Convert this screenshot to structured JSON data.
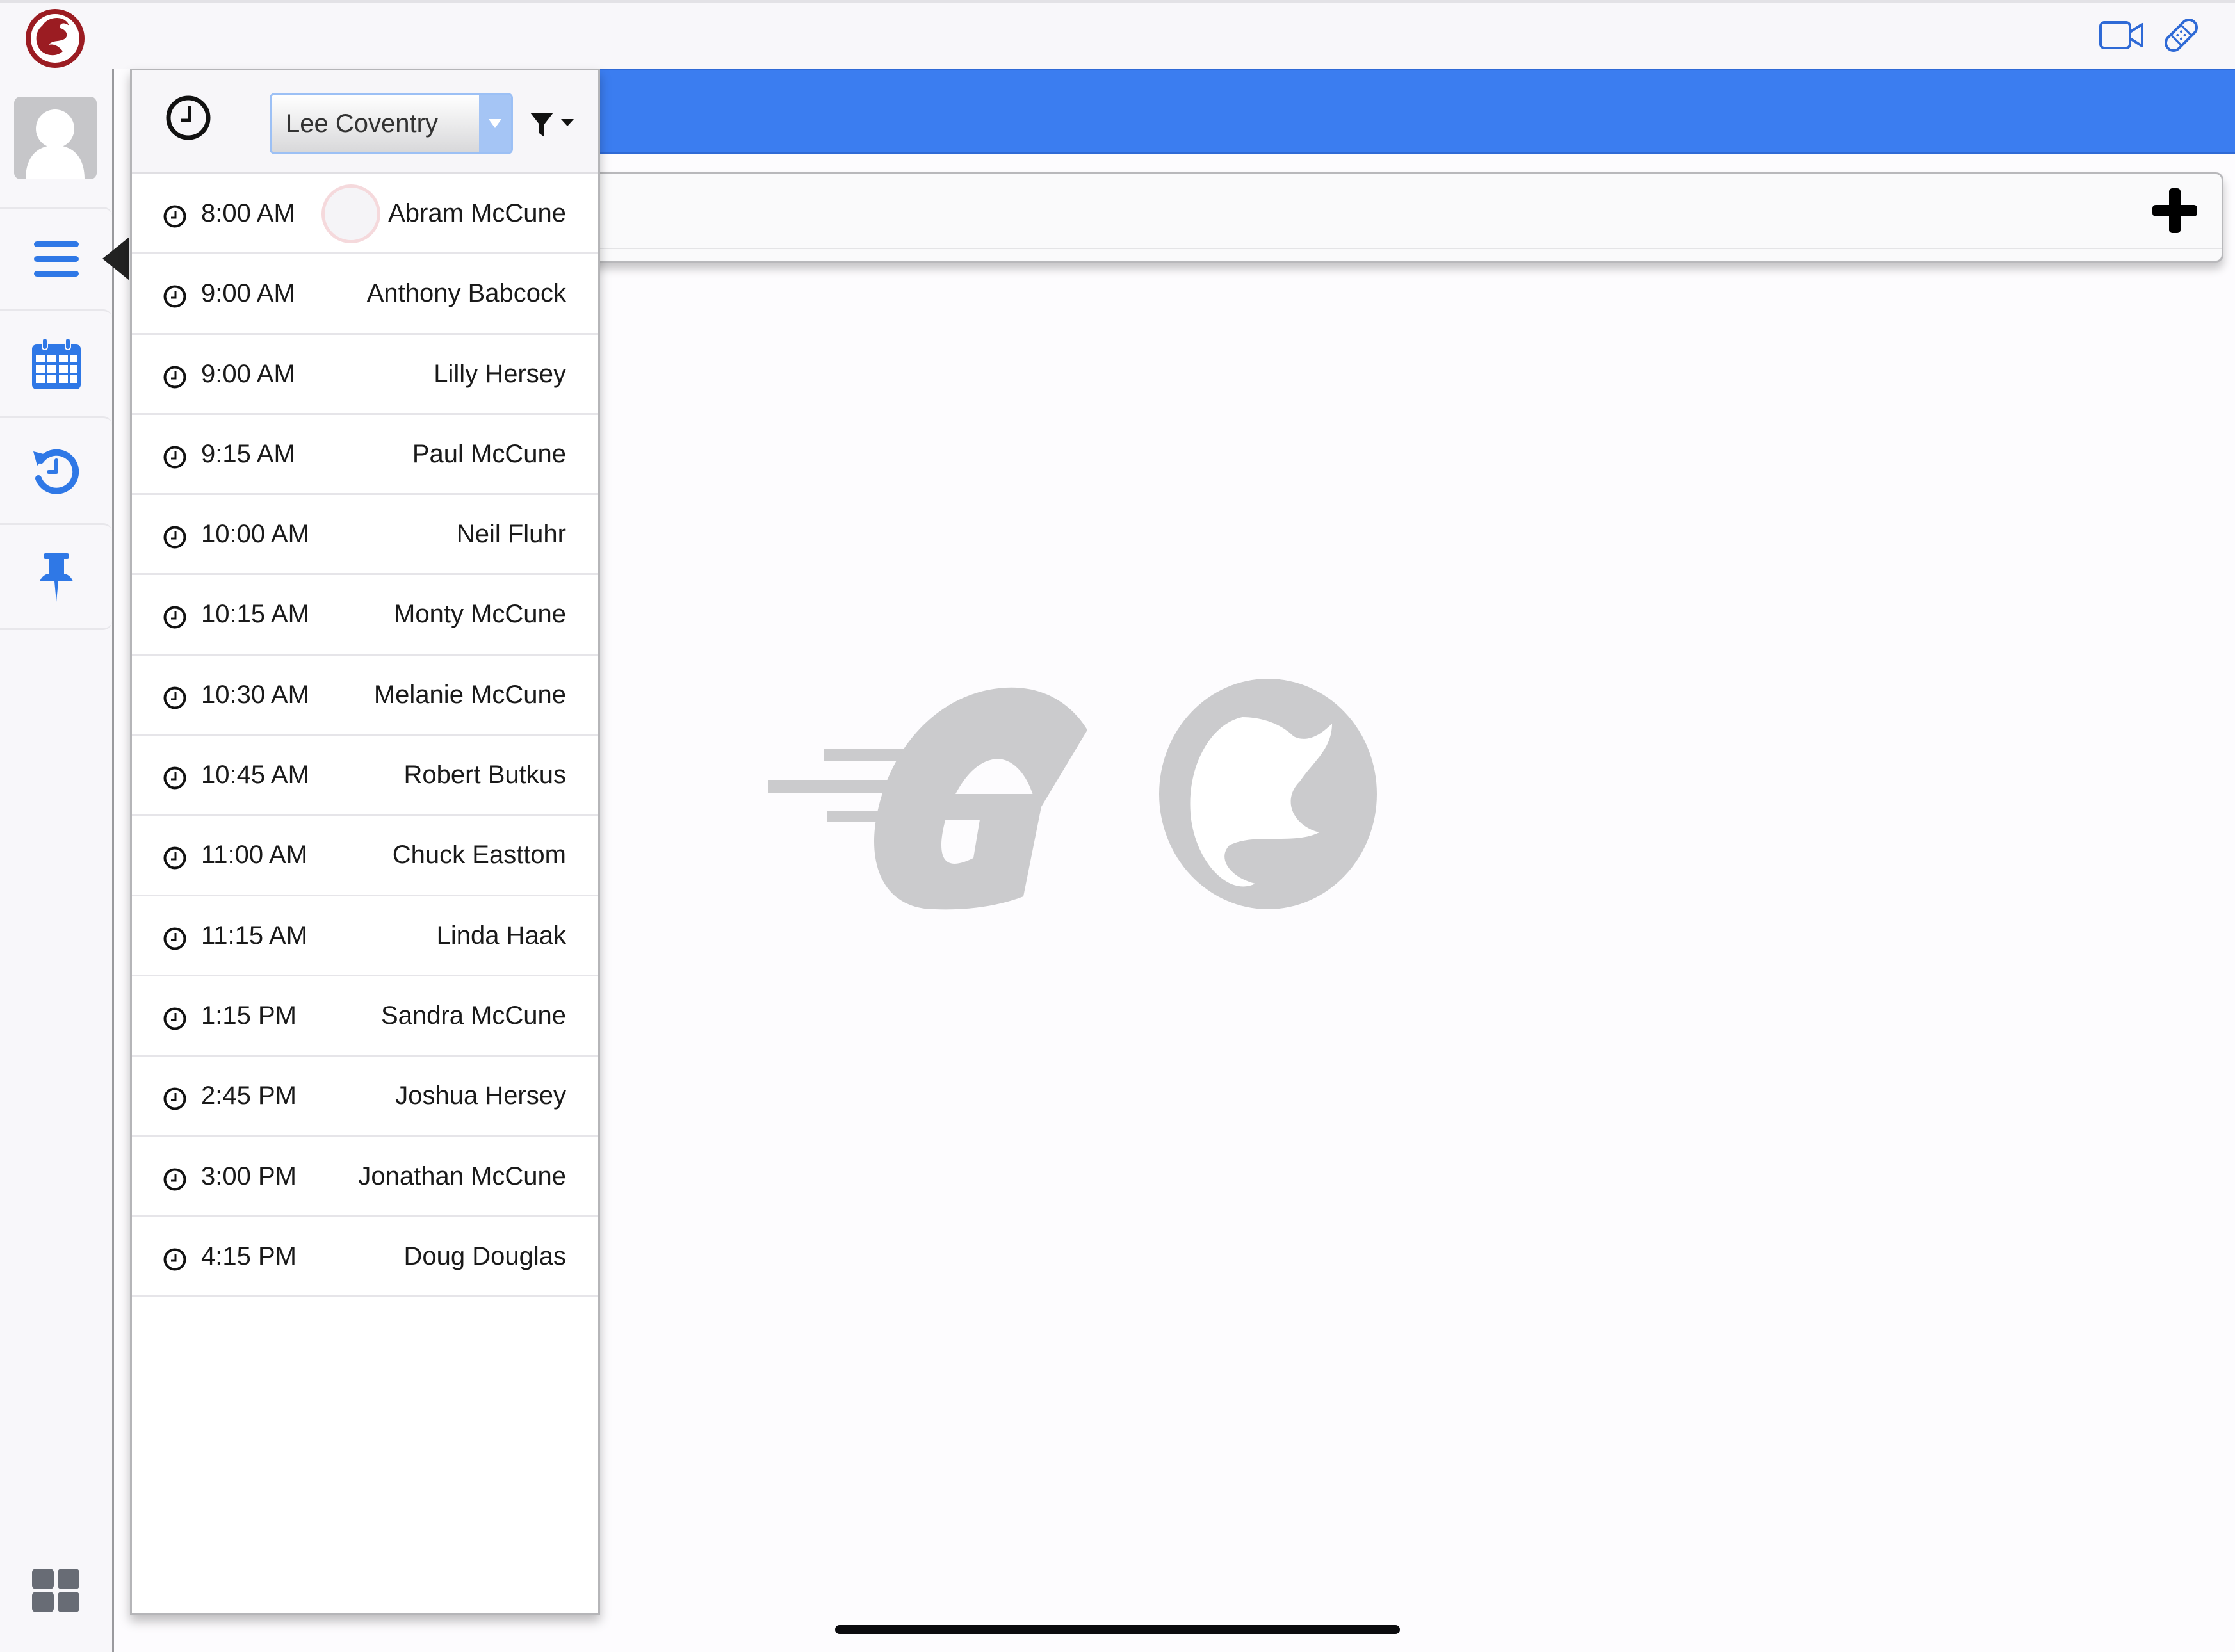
{
  "topbar": {
    "logo_icon": "app-logo-dragon",
    "right_icons": [
      "video-camera-icon",
      "bandage-icon"
    ]
  },
  "sidebar": {
    "avatar_icon": "user-avatar-placeholder",
    "items": [
      {
        "icon": "hamburger-menu-icon",
        "active": true
      },
      {
        "icon": "calendar-icon"
      },
      {
        "icon": "history-icon"
      },
      {
        "icon": "pin-icon"
      }
    ],
    "bottom_icon": "grid-icon"
  },
  "panel": {
    "header_icon": "clock-icon",
    "provider_select": {
      "value": "Lee Coventry"
    },
    "filter_icon": "filter-icon",
    "appointments": [
      {
        "time": "8:00 AM",
        "name": "Abram McCune"
      },
      {
        "time": "9:00 AM",
        "name": "Anthony Babcock"
      },
      {
        "time": "9:00 AM",
        "name": "Lilly Hersey"
      },
      {
        "time": "9:15 AM",
        "name": "Paul McCune"
      },
      {
        "time": "10:00 AM",
        "name": "Neil Fluhr"
      },
      {
        "time": "10:15 AM",
        "name": "Monty McCune"
      },
      {
        "time": "10:30 AM",
        "name": "Melanie McCune"
      },
      {
        "time": "10:45 AM",
        "name": "Robert Butkus"
      },
      {
        "time": "11:00 AM",
        "name": "Chuck Easttom"
      },
      {
        "time": "11:15 AM",
        "name": "Linda Haak"
      },
      {
        "time": "1:15 PM",
        "name": "Sandra McCune"
      },
      {
        "time": "2:45 PM",
        "name": "Joshua Hersey"
      },
      {
        "time": "3:00 PM",
        "name": "Jonathan McCune"
      },
      {
        "time": "4:15 PM",
        "name": "Doug Douglas"
      }
    ]
  },
  "main": {
    "add_icon": "plus-icon",
    "watermark": "GO"
  },
  "colors": {
    "accent_blue": "#3b7df0",
    "sidebar_icon_blue": "#2f78e6",
    "logo_red": "#9b1c22",
    "watermark_gray": "#cbcbcd"
  }
}
